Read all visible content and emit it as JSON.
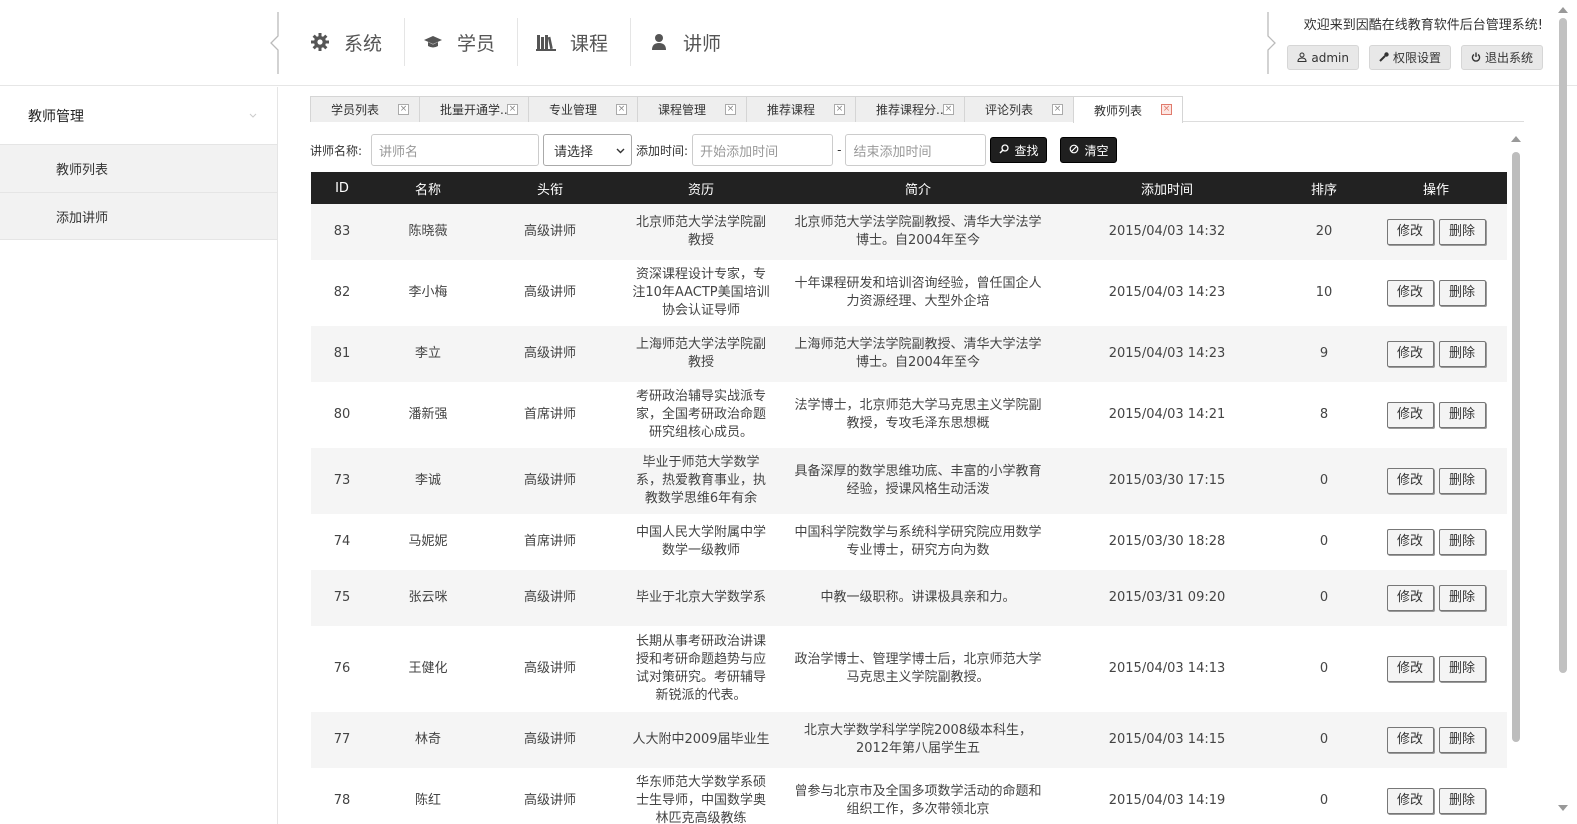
{
  "header": {
    "nav": [
      {
        "label": "系统",
        "icon": "gear-icon"
      },
      {
        "label": "学员",
        "icon": "graduation-cap-icon"
      },
      {
        "label": "课程",
        "icon": "books-icon"
      },
      {
        "label": "讲师",
        "icon": "user-icon"
      }
    ],
    "welcome": "欢迎来到因酷在线教育软件后台管理系统!",
    "buttons": {
      "admin": "admin",
      "permissions": "权限设置",
      "logout": "退出系统"
    }
  },
  "sidebar": {
    "group": "教师管理",
    "items": [
      {
        "label": "教师列表"
      },
      {
        "label": "添加讲师"
      }
    ]
  },
  "tabs": [
    {
      "label": "学员列表",
      "active": false
    },
    {
      "label": "批量开通学...",
      "active": false
    },
    {
      "label": "专业管理",
      "active": false
    },
    {
      "label": "课程管理",
      "active": false
    },
    {
      "label": "推荐课程",
      "active": false
    },
    {
      "label": "推荐课程分...",
      "active": false
    },
    {
      "label": "评论列表",
      "active": false
    },
    {
      "label": "教师列表",
      "active": true
    }
  ],
  "search": {
    "name_label": "讲师名称:",
    "name_placeholder": "讲师名",
    "select_value": "请选择",
    "time_label": "添加时间:",
    "start_placeholder": "开始添加时间",
    "separator": "-",
    "end_placeholder": "结束添加时间",
    "search_btn": "查找",
    "clear_btn": "清空"
  },
  "table": {
    "headers": [
      "ID",
      "名称",
      "头衔",
      "资历",
      "简介",
      "添加时间",
      "排序",
      "操作"
    ],
    "edit_label": "修改",
    "delete_label": "删除",
    "rows": [
      {
        "id": "83",
        "name": "陈晓薇",
        "title": "高级讲师",
        "career": "北京师范大学法学院副教授",
        "intro": "北京师范大学法学院副教授、清华大学法学博士。自2004年至今",
        "time": "2015/04/03 14:32",
        "sort": "20"
      },
      {
        "id": "82",
        "name": "李小梅",
        "title": "高级讲师",
        "career": "资深课程设计专家，专注10年AACTP美国培训协会认证导师",
        "intro": "十年课程研发和培训咨询经验，曾任国企人力资源经理、大型外企培",
        "time": "2015/04/03 14:23",
        "sort": "10"
      },
      {
        "id": "81",
        "name": "李立",
        "title": "高级讲师",
        "career": "上海师范大学法学院副教授",
        "intro": "上海师范大学法学院副教授、清华大学法学博士。自2004年至今",
        "time": "2015/04/03 14:23",
        "sort": "9"
      },
      {
        "id": "80",
        "name": "潘新强",
        "title": "首席讲师",
        "career": "考研政治辅导实战派专家，全国考研政治命题研究组核心成员。",
        "intro": "法学博士，北京师范大学马克思主义学院副教授，专攻毛泽东思想概",
        "time": "2015/04/03 14:21",
        "sort": "8"
      },
      {
        "id": "73",
        "name": "李诚",
        "title": "高级讲师",
        "career": "毕业于师范大学数学系，热爱教育事业，执教数学思维6年有余",
        "intro": "具备深厚的数学思维功底、丰富的小学教育经验，授课风格生动活泼",
        "time": "2015/03/30 17:15",
        "sort": "0"
      },
      {
        "id": "74",
        "name": "马妮妮",
        "title": "首席讲师",
        "career": "中国人民大学附属中学数学一级教师",
        "intro": "中国科学院数学与系统科学研究院应用数学专业博士，研究方向为数",
        "time": "2015/03/30 18:28",
        "sort": "0"
      },
      {
        "id": "75",
        "name": "张云咪",
        "title": "高级讲师",
        "career": "毕业于北京大学数学系",
        "intro": "中教一级职称。讲课极具亲和力。",
        "time": "2015/03/31 09:20",
        "sort": "0"
      },
      {
        "id": "76",
        "name": "王健化",
        "title": "高级讲师",
        "career": "长期从事考研政治讲课授和考研命题趋势与应试对策研究。考研辅导新锐派的代表。",
        "intro": "政治学博士、管理学博士后，北京师范大学马克思主义学院副教授。",
        "time": "2015/04/03 14:13",
        "sort": "0"
      },
      {
        "id": "77",
        "name": "林奇",
        "title": "高级讲师",
        "career": "人大附中2009届毕业生",
        "intro": "北京大学数学科学学院2008级本科生，2012年第八届学生五",
        "time": "2015/04/03 14:15",
        "sort": "0"
      },
      {
        "id": "78",
        "name": "陈红",
        "title": "高级讲师",
        "career": "华东师范大学数学系硕士生导师，中国数学奥林匹克高级教练",
        "intro": "曾参与北京市及全国多项数学活动的命题和组织工作，多次带领北京",
        "time": "2015/04/03 14:19",
        "sort": "0"
      }
    ]
  }
}
